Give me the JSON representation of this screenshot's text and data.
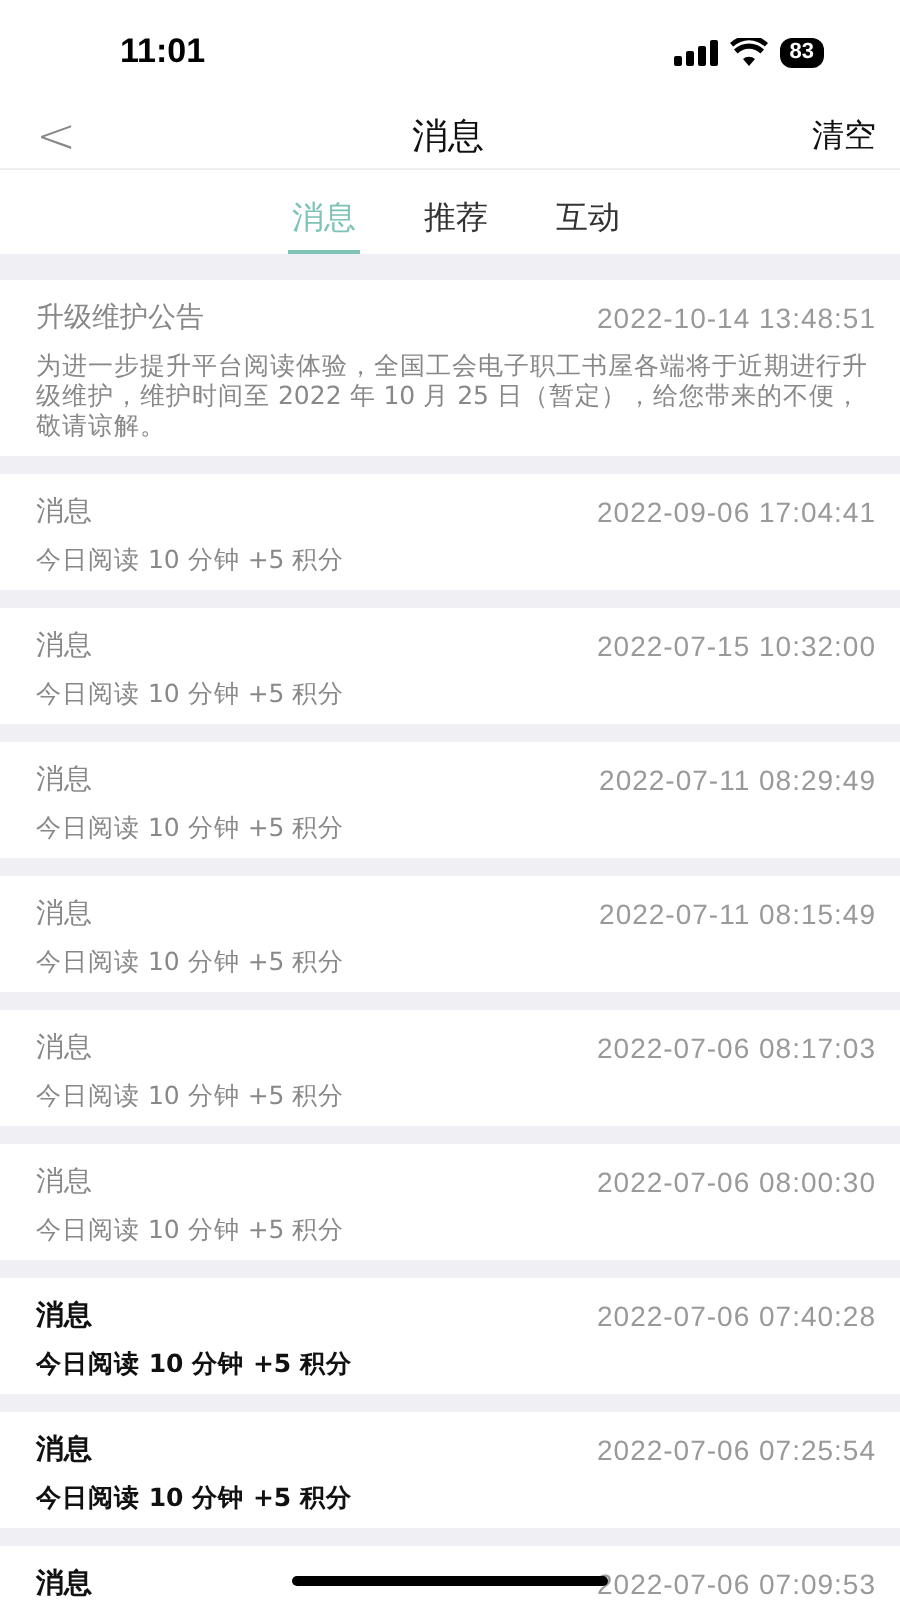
{
  "status_bar": {
    "time": "11:01",
    "battery": "83"
  },
  "nav": {
    "back": "<",
    "title": "消息",
    "action": "清空"
  },
  "tabs": [
    {
      "label": "消息",
      "selected": true
    },
    {
      "label": "推荐",
      "selected": false
    },
    {
      "label": "互动",
      "selected": false
    }
  ],
  "messages": [
    {
      "title": "升级维护公告",
      "time": "2022-10-14 13:48:51",
      "body": "为进一步提升平台阅读体验，全国工会电子职工书屋各端将于近期进行升级维护，维护时间至 2022 年 10 月 25 日（暂定），给您带来的不便，敬请谅解。",
      "read": true
    },
    {
      "title": "消息",
      "time": "2022-09-06 17:04:41",
      "body": "今日阅读 10 分钟 +5 积分",
      "read": true
    },
    {
      "title": "消息",
      "time": "2022-07-15 10:32:00",
      "body": "今日阅读 10 分钟 +5 积分",
      "read": true
    },
    {
      "title": "消息",
      "time": "2022-07-11 08:29:49",
      "body": "今日阅读 10 分钟 +5 积分",
      "read": true
    },
    {
      "title": "消息",
      "time": "2022-07-11 08:15:49",
      "body": "今日阅读 10 分钟 +5 积分",
      "read": true
    },
    {
      "title": "消息",
      "time": "2022-07-06 08:17:03",
      "body": "今日阅读 10 分钟 +5 积分",
      "read": true
    },
    {
      "title": "消息",
      "time": "2022-07-06 08:00:30",
      "body": "今日阅读 10 分钟 +5 积分",
      "read": true
    },
    {
      "title": "消息",
      "time": "2022-07-06 07:40:28",
      "body": "今日阅读 10 分钟 +5 积分",
      "read": false
    },
    {
      "title": "消息",
      "time": "2022-07-06 07:25:54",
      "body": "今日阅读 10 分钟 +5 积分",
      "read": false
    },
    {
      "title": "消息",
      "time": "2022-07-06 07:09:53",
      "read": false
    }
  ]
}
